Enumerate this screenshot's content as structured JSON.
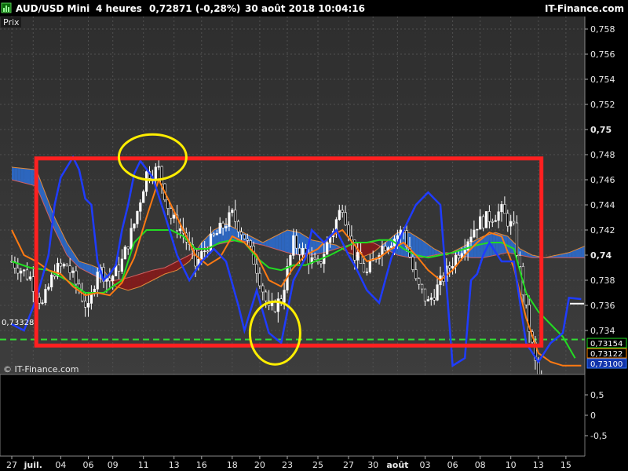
{
  "header": {
    "symbol": "AUD/USD Mini",
    "timeframe": "4 heures",
    "last": "0,72871 (-0,28%)",
    "datetime": "30 août 2018 10:04:16",
    "brand": "IT-Finance.com"
  },
  "price_panel": {
    "label": "Prix",
    "watermark": "© IT-Finance.com",
    "left_level_tag": "0,73328",
    "right_tags": [
      {
        "text": "0,73154",
        "color": "#22dd22"
      },
      {
        "text": "0,73122",
        "color": "#ff8800"
      },
      {
        "text": "0,73100",
        "color": "#3377ff"
      }
    ]
  },
  "colors": {
    "panel_bg": "#3d3d3d",
    "panel_bg_top": "#2e2e2e",
    "grid": "#505050",
    "candle": "#ffffff",
    "fast_line": "#1f3cff",
    "slow_line": "#ff7a12",
    "mid_line": "#22dd22",
    "cloud_bull": "#2c6fd6",
    "cloud_bear": "#8c1717",
    "box": "#ff2020",
    "circle": "#ffee00",
    "dashed": "#33dd33"
  },
  "chart_data": {
    "type": "candlestick",
    "y_axis": {
      "range": [
        0.7305,
        0.759
      ],
      "ticks": [
        "0,758",
        "0,756",
        "0,754",
        "0,752",
        "0,75",
        "0,748",
        "0,746",
        "0,744",
        "0,742",
        "0,74",
        "0,738",
        "0,736",
        "0,734"
      ],
      "tick_values": [
        0.758,
        0.756,
        0.754,
        0.752,
        0.75,
        0.748,
        0.746,
        0.744,
        0.742,
        0.74,
        0.738,
        0.736,
        0.734
      ],
      "bold_ticks": [
        "0,75",
        "0,74"
      ]
    },
    "x_axis": {
      "labels": [
        "27",
        "juil.",
        "04",
        "06",
        "09",
        "11",
        "13",
        "16",
        "18",
        "20",
        "23",
        "25",
        "27",
        "30",
        "août",
        "03",
        "06",
        "08",
        "10",
        "13",
        "15"
      ],
      "bold_labels": [
        "juil.",
        "août"
      ],
      "bar_index": [
        0,
        7,
        16,
        25,
        33,
        43,
        53,
        62,
        72,
        81,
        90,
        100,
        110,
        118,
        126,
        135,
        144,
        153,
        163,
        172,
        181
      ]
    },
    "dashed_level": 0.73328,
    "highlights": {
      "rectangle": {
        "from_bar": 8,
        "to_bar": 173,
        "top": 0.7477,
        "bottom": 0.7328
      },
      "circles": [
        {
          "bar": 46,
          "price": 0.7478,
          "label": "high"
        },
        {
          "bar": 86,
          "price": 0.7338,
          "label": "low"
        }
      ]
    },
    "close_path": [
      [
        0,
        0.7395
      ],
      [
        6,
        0.7382
      ],
      [
        10,
        0.736
      ],
      [
        14,
        0.7388
      ],
      [
        18,
        0.7392
      ],
      [
        22,
        0.7372
      ],
      [
        25,
        0.7356
      ],
      [
        28,
        0.739
      ],
      [
        32,
        0.738
      ],
      [
        36,
        0.7395
      ],
      [
        40,
        0.7425
      ],
      [
        44,
        0.7465
      ],
      [
        48,
        0.7468
      ],
      [
        52,
        0.743
      ],
      [
        56,
        0.7418
      ],
      [
        60,
        0.7392
      ],
      [
        64,
        0.7408
      ],
      [
        68,
        0.742
      ],
      [
        72,
        0.7432
      ],
      [
        76,
        0.7415
      ],
      [
        80,
        0.739
      ],
      [
        84,
        0.7355
      ],
      [
        88,
        0.7365
      ],
      [
        92,
        0.741
      ],
      [
        96,
        0.74
      ],
      [
        100,
        0.739
      ],
      [
        104,
        0.7415
      ],
      [
        108,
        0.744
      ],
      [
        112,
        0.74
      ],
      [
        116,
        0.7385
      ],
      [
        120,
        0.7405
      ],
      [
        124,
        0.7412
      ],
      [
        128,
        0.742
      ],
      [
        132,
        0.7378
      ],
      [
        136,
        0.7362
      ],
      [
        140,
        0.7378
      ],
      [
        144,
        0.7395
      ],
      [
        148,
        0.741
      ],
      [
        152,
        0.7425
      ],
      [
        156,
        0.743
      ],
      [
        160,
        0.7435
      ],
      [
        164,
        0.742
      ],
      [
        168,
        0.7355
      ],
      [
        172,
        0.73
      ],
      [
        176,
        0.728
      ],
      [
        180,
        0.727
      ],
      [
        186,
        0.7288
      ]
    ],
    "fast_line": [
      [
        0,
        0.7345
      ],
      [
        4,
        0.734
      ],
      [
        8,
        0.7365
      ],
      [
        12,
        0.74
      ],
      [
        14,
        0.744
      ],
      [
        16,
        0.7462
      ],
      [
        18,
        0.747
      ],
      [
        20,
        0.7478
      ],
      [
        22,
        0.7468
      ],
      [
        24,
        0.7445
      ],
      [
        26,
        0.744
      ],
      [
        28,
        0.7395
      ],
      [
        30,
        0.738
      ],
      [
        32,
        0.7385
      ],
      [
        34,
        0.7392
      ],
      [
        36,
        0.742
      ],
      [
        38,
        0.744
      ],
      [
        40,
        0.7465
      ],
      [
        42,
        0.7475
      ],
      [
        46,
        0.7462
      ],
      [
        50,
        0.7432
      ],
      [
        54,
        0.74
      ],
      [
        58,
        0.738
      ],
      [
        62,
        0.7395
      ],
      [
        66,
        0.7405
      ],
      [
        70,
        0.7395
      ],
      [
        74,
        0.736
      ],
      [
        76,
        0.734
      ],
      [
        80,
        0.7372
      ],
      [
        84,
        0.7338
      ],
      [
        88,
        0.733
      ],
      [
        92,
        0.738
      ],
      [
        96,
        0.7398
      ],
      [
        98,
        0.742
      ],
      [
        102,
        0.741
      ],
      [
        106,
        0.742
      ],
      [
        110,
        0.74
      ],
      [
        112,
        0.7392
      ],
      [
        116,
        0.7372
      ],
      [
        120,
        0.7362
      ],
      [
        124,
        0.7398
      ],
      [
        128,
        0.742
      ],
      [
        132,
        0.744
      ],
      [
        136,
        0.745
      ],
      [
        140,
        0.744
      ],
      [
        144,
        0.7312
      ],
      [
        148,
        0.7318
      ],
      [
        150,
        0.738
      ],
      [
        152,
        0.7385
      ],
      [
        154,
        0.74
      ],
      [
        156,
        0.741
      ],
      [
        160,
        0.7395
      ],
      [
        164,
        0.7395
      ],
      [
        168,
        0.733
      ],
      [
        172,
        0.7315
      ],
      [
        176,
        0.733
      ],
      [
        180,
        0.7338
      ],
      [
        182,
        0.7366
      ],
      [
        186,
        0.7365
      ]
    ],
    "slow_line": [
      [
        0,
        0.742
      ],
      [
        4,
        0.74
      ],
      [
        8,
        0.7395
      ],
      [
        12,
        0.7388
      ],
      [
        16,
        0.7385
      ],
      [
        20,
        0.7375
      ],
      [
        24,
        0.7368
      ],
      [
        28,
        0.737
      ],
      [
        32,
        0.7368
      ],
      [
        36,
        0.7378
      ],
      [
        40,
        0.7398
      ],
      [
        44,
        0.743
      ],
      [
        48,
        0.746
      ],
      [
        52,
        0.744
      ],
      [
        56,
        0.742
      ],
      [
        60,
        0.74
      ],
      [
        64,
        0.7392
      ],
      [
        68,
        0.7398
      ],
      [
        72,
        0.7415
      ],
      [
        76,
        0.741
      ],
      [
        80,
        0.74
      ],
      [
        84,
        0.738
      ],
      [
        88,
        0.7375
      ],
      [
        92,
        0.739
      ],
      [
        96,
        0.74
      ],
      [
        100,
        0.7405
      ],
      [
        104,
        0.7415
      ],
      [
        108,
        0.742
      ],
      [
        112,
        0.7408
      ],
      [
        116,
        0.7395
      ],
      [
        120,
        0.7398
      ],
      [
        124,
        0.7405
      ],
      [
        128,
        0.741
      ],
      [
        132,
        0.74
      ],
      [
        136,
        0.7388
      ],
      [
        140,
        0.738
      ],
      [
        144,
        0.7388
      ],
      [
        148,
        0.74
      ],
      [
        152,
        0.741
      ],
      [
        156,
        0.7418
      ],
      [
        160,
        0.7415
      ],
      [
        164,
        0.739
      ],
      [
        168,
        0.735
      ],
      [
        172,
        0.7322
      ],
      [
        176,
        0.7315
      ],
      [
        180,
        0.7312
      ],
      [
        186,
        0.7312
      ]
    ],
    "mid_line": [
      [
        0,
        0.7395
      ],
      [
        6,
        0.739
      ],
      [
        12,
        0.7388
      ],
      [
        18,
        0.738
      ],
      [
        24,
        0.737
      ],
      [
        30,
        0.737
      ],
      [
        36,
        0.738
      ],
      [
        40,
        0.741
      ],
      [
        44,
        0.742
      ],
      [
        48,
        0.742
      ],
      [
        52,
        0.742
      ],
      [
        56,
        0.7415
      ],
      [
        60,
        0.7405
      ],
      [
        64,
        0.7405
      ],
      [
        68,
        0.741
      ],
      [
        72,
        0.7412
      ],
      [
        76,
        0.741
      ],
      [
        80,
        0.7398
      ],
      [
        84,
        0.739
      ],
      [
        88,
        0.7388
      ],
      [
        92,
        0.7392
      ],
      [
        96,
        0.7392
      ],
      [
        100,
        0.7396
      ],
      [
        104,
        0.74
      ],
      [
        108,
        0.7405
      ],
      [
        112,
        0.741
      ],
      [
        116,
        0.741
      ],
      [
        120,
        0.7412
      ],
      [
        124,
        0.7412
      ],
      [
        128,
        0.7405
      ],
      [
        132,
        0.74
      ],
      [
        136,
        0.7398
      ],
      [
        140,
        0.74
      ],
      [
        144,
        0.7402
      ],
      [
        148,
        0.7405
      ],
      [
        152,
        0.7408
      ],
      [
        156,
        0.741
      ],
      [
        160,
        0.741
      ],
      [
        164,
        0.7405
      ],
      [
        168,
        0.737
      ],
      [
        172,
        0.7355
      ],
      [
        176,
        0.7345
      ],
      [
        180,
        0.7335
      ],
      [
        184,
        0.7318
      ]
    ],
    "cloud": {
      "span_a": [
        [
          0,
          0.747
        ],
        [
          8,
          0.7468
        ],
        [
          14,
          0.743
        ],
        [
          18,
          0.741
        ],
        [
          22,
          0.7395
        ],
        [
          26,
          0.7392
        ],
        [
          30,
          0.7388
        ],
        [
          34,
          0.7375
        ],
        [
          38,
          0.7372
        ],
        [
          42,
          0.7375
        ],
        [
          46,
          0.738
        ],
        [
          50,
          0.7385
        ],
        [
          54,
          0.7388
        ],
        [
          58,
          0.7395
        ],
        [
          62,
          0.741
        ],
        [
          66,
          0.742
        ],
        [
          70,
          0.7425
        ],
        [
          74,
          0.742
        ],
        [
          78,
          0.7415
        ],
        [
          82,
          0.741
        ],
        [
          86,
          0.7415
        ],
        [
          90,
          0.742
        ],
        [
          94,
          0.7418
        ],
        [
          98,
          0.7412
        ],
        [
          102,
          0.741
        ],
        [
          106,
          0.7408
        ],
        [
          110,
          0.7402
        ],
        [
          114,
          0.7398
        ],
        [
          118,
          0.7402
        ],
        [
          122,
          0.741
        ],
        [
          126,
          0.7418
        ],
        [
          130,
          0.7418
        ],
        [
          134,
          0.7412
        ],
        [
          138,
          0.7405
        ],
        [
          142,
          0.74
        ],
        [
          146,
          0.7405
        ],
        [
          150,
          0.741
        ],
        [
          154,
          0.7415
        ],
        [
          158,
          0.7418
        ],
        [
          162,
          0.7415
        ],
        [
          166,
          0.7405
        ],
        [
          170,
          0.74
        ],
        [
          174,
          0.7398
        ],
        [
          178,
          0.74
        ],
        [
          182,
          0.7402
        ],
        [
          188,
          0.7408
        ]
      ],
      "span_b": [
        [
          0,
          0.746
        ],
        [
          8,
          0.7455
        ],
        [
          14,
          0.742
        ],
        [
          18,
          0.74
        ],
        [
          22,
          0.739
        ],
        [
          26,
          0.7385
        ],
        [
          30,
          0.738
        ],
        [
          34,
          0.738
        ],
        [
          38,
          0.7382
        ],
        [
          42,
          0.7385
        ],
        [
          46,
          0.7388
        ],
        [
          50,
          0.739
        ],
        [
          54,
          0.7395
        ],
        [
          58,
          0.74
        ],
        [
          62,
          0.7405
        ],
        [
          66,
          0.7408
        ],
        [
          70,
          0.741
        ],
        [
          74,
          0.7412
        ],
        [
          78,
          0.741
        ],
        [
          82,
          0.7408
        ],
        [
          86,
          0.7405
        ],
        [
          90,
          0.7402
        ],
        [
          94,
          0.74
        ],
        [
          98,
          0.74
        ],
        [
          102,
          0.7402
        ],
        [
          106,
          0.7405
        ],
        [
          110,
          0.7408
        ],
        [
          114,
          0.741
        ],
        [
          118,
          0.741
        ],
        [
          122,
          0.7405
        ],
        [
          126,
          0.74
        ],
        [
          130,
          0.7398
        ],
        [
          134,
          0.7398
        ],
        [
          138,
          0.74
        ],
        [
          142,
          0.7402
        ],
        [
          146,
          0.74
        ],
        [
          150,
          0.7398
        ],
        [
          154,
          0.7398
        ],
        [
          158,
          0.74
        ],
        [
          162,
          0.7402
        ],
        [
          166,
          0.74
        ],
        [
          170,
          0.7398
        ],
        [
          174,
          0.7398
        ],
        [
          178,
          0.7398
        ],
        [
          182,
          0.7398
        ],
        [
          188,
          0.7398
        ]
      ]
    },
    "oscillator_axis": {
      "ticks": [
        "0,5",
        "0",
        "-0,5"
      ],
      "tick_values": [
        0.5,
        0,
        -0.5
      ],
      "range": [
        -1,
        1
      ]
    }
  }
}
